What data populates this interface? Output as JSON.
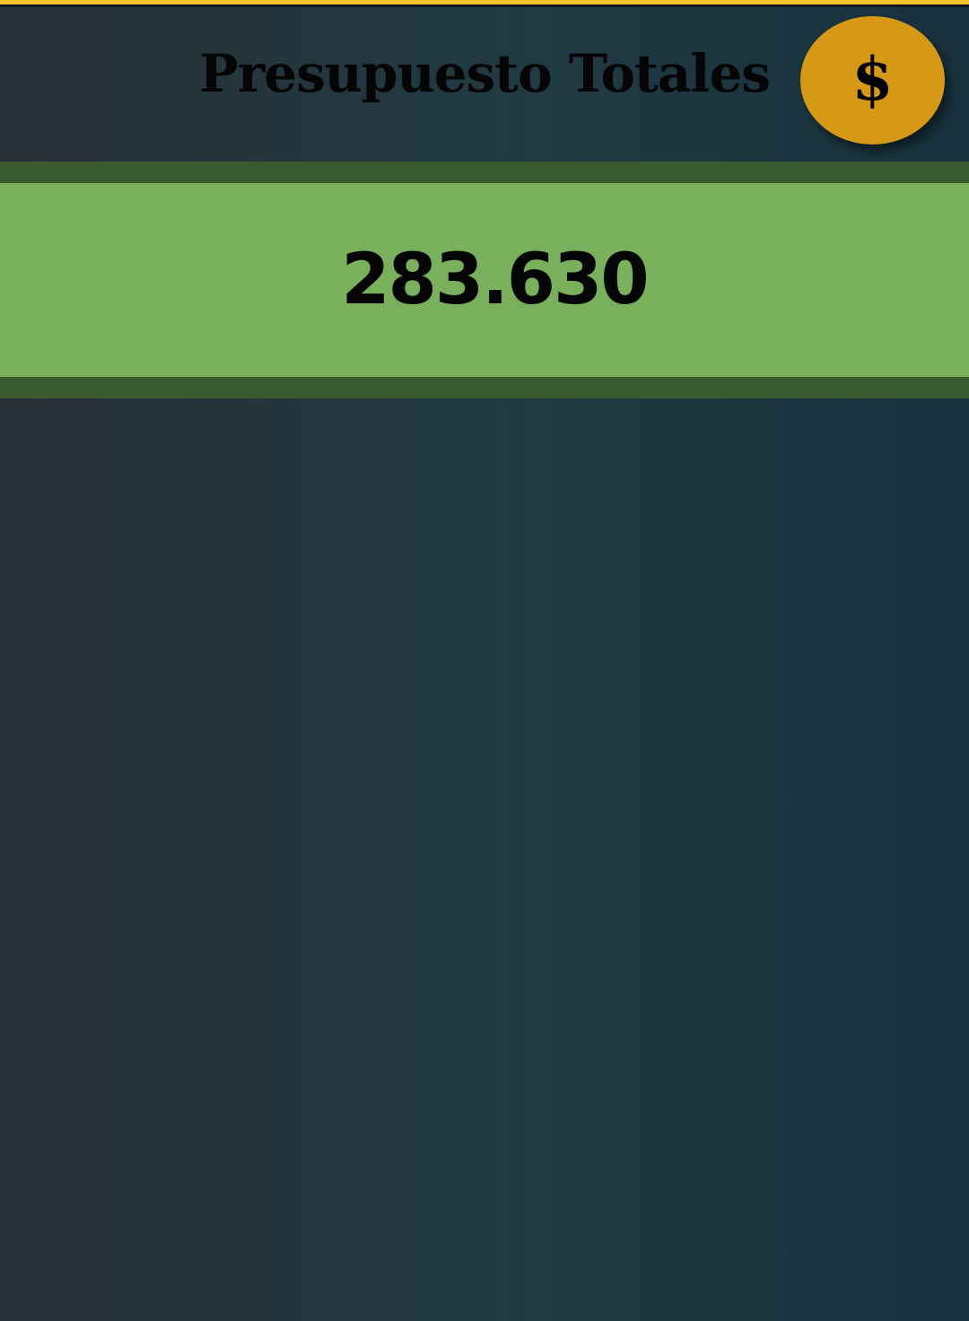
{
  "header": {
    "title": "Presupuesto Totales",
    "action_button_icon": "dollar-coin-icon",
    "action_button_glyph": "$"
  },
  "budget": {
    "total_value": "283.630"
  },
  "colors": {
    "accent_bar": "#f3c12a",
    "coin_button": "#d69915",
    "band_outer": "#3b5a2e",
    "band_inner": "#79b05b",
    "background_start": "#283136",
    "background_end": "#17323d"
  }
}
